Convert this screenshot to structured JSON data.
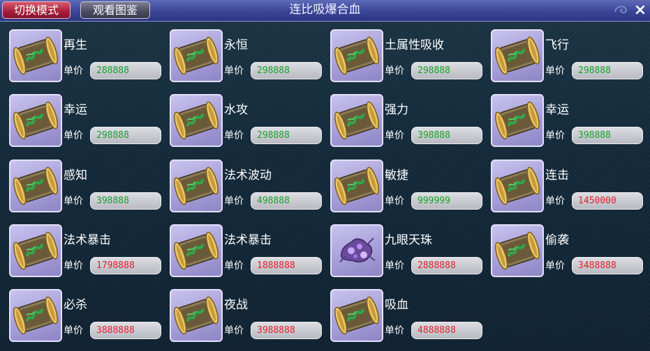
{
  "header": {
    "switch_label": "切换模式",
    "view_label": "观看图鉴",
    "title": "连比吸爆合血",
    "close_label": "×"
  },
  "price_label": "单价",
  "items": [
    {
      "name": "再生",
      "price": "288888",
      "price_color": "#18a02a",
      "icon": "scroll-icon"
    },
    {
      "name": "永恒",
      "price": "298888",
      "price_color": "#18a02a",
      "icon": "scroll-icon"
    },
    {
      "name": "土属性吸收",
      "price": "298888",
      "price_color": "#18a02a",
      "icon": "scroll-icon"
    },
    {
      "name": "飞行",
      "price": "298888",
      "price_color": "#18a02a",
      "icon": "scroll-icon"
    },
    {
      "name": "幸运",
      "price": "298888",
      "price_color": "#18a02a",
      "icon": "scroll-icon"
    },
    {
      "name": "水攻",
      "price": "298888",
      "price_color": "#18a02a",
      "icon": "scroll-icon"
    },
    {
      "name": "强力",
      "price": "398888",
      "price_color": "#18a02a",
      "icon": "scroll-icon"
    },
    {
      "name": "幸运",
      "price": "398888",
      "price_color": "#18a02a",
      "icon": "scroll-icon"
    },
    {
      "name": "感知",
      "price": "398888",
      "price_color": "#18a02a",
      "icon": "scroll-icon"
    },
    {
      "name": "法术波动",
      "price": "498888",
      "price_color": "#18a02a",
      "icon": "scroll-icon"
    },
    {
      "name": "敏捷",
      "price": "999999",
      "price_color": "#18a02a",
      "icon": "scroll-icon"
    },
    {
      "name": "连击",
      "price": "1450000",
      "price_color": "#e2202c",
      "icon": "scroll-icon"
    },
    {
      "name": "法术暴击",
      "price": "1798888",
      "price_color": "#e2202c",
      "icon": "scroll-icon"
    },
    {
      "name": "法术暴击",
      "price": "1888888",
      "price_color": "#e2202c",
      "icon": "scroll-icon"
    },
    {
      "name": "九眼天珠",
      "price": "2888888",
      "price_color": "#e2202c",
      "icon": "gem-icon"
    },
    {
      "name": "偷袭",
      "price": "3488888",
      "price_color": "#e2202c",
      "icon": "scroll-icon"
    },
    {
      "name": "必杀",
      "price": "3888888",
      "price_color": "#e2202c",
      "icon": "scroll-icon"
    },
    {
      "name": "夜战",
      "price": "3988888",
      "price_color": "#e2202c",
      "icon": "scroll-icon"
    },
    {
      "name": "吸血",
      "price": "4888888",
      "price_color": "#e2202c",
      "icon": "scroll-icon"
    }
  ]
}
